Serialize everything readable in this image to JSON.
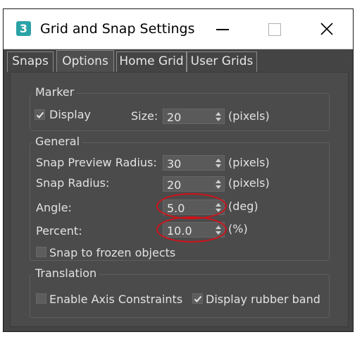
{
  "window": {
    "title": "Grid and Snap Settings",
    "app_icon_text": "3"
  },
  "tabs": [
    {
      "label": "Snaps",
      "active": false
    },
    {
      "label": "Options",
      "active": true
    },
    {
      "label": "Home Grid",
      "active": false
    },
    {
      "label": "User Grids",
      "active": false
    }
  ],
  "marker": {
    "group_label": "Marker",
    "display_label": "Display",
    "display_checked": true,
    "size_label": "Size:",
    "size_value": "20",
    "size_unit": "(pixels)"
  },
  "general": {
    "group_label": "General",
    "snap_preview_radius_label": "Snap Preview Radius:",
    "snap_preview_radius_value": "30",
    "snap_preview_radius_unit": "(pixels)",
    "snap_radius_label": "Snap Radius:",
    "snap_radius_value": "20",
    "snap_radius_unit": "(pixels)",
    "angle_label": "Angle:",
    "angle_value": "5.0",
    "angle_unit": "(deg)",
    "percent_label": "Percent:",
    "percent_value": "10.0",
    "percent_unit": "(%)",
    "snap_frozen_label": "Snap to frozen objects",
    "snap_frozen_checked": false
  },
  "translation": {
    "group_label": "Translation",
    "axis_constraints_label": "Enable Axis Constraints",
    "axis_constraints_checked": false,
    "rubber_band_label": "Display rubber band",
    "rubber_band_checked": true
  },
  "colors": {
    "dialog_bg": "#444444",
    "panel_bg": "#4b4b4b",
    "highlight_ring": "#d0121b",
    "app_icon": "#2aa3a7"
  }
}
